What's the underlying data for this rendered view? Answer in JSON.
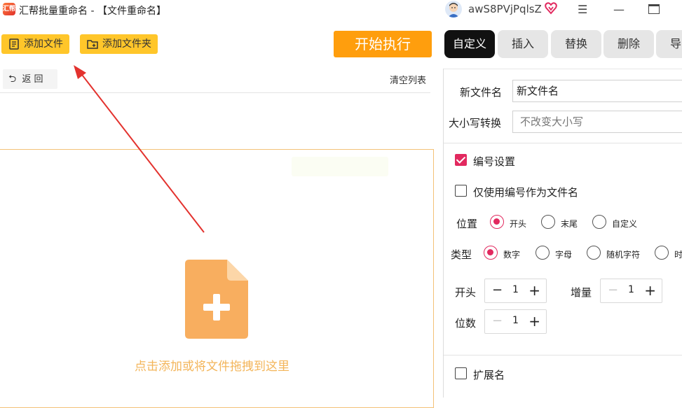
{
  "window": {
    "title": "汇帮批量重命名 - 【文件重命名】",
    "username": "awS8PVjPqlsZ",
    "logo_text": "汇帮"
  },
  "toolbar": {
    "add_file": "添加文件",
    "add_folder": "添加文件夹",
    "start": "开始执行"
  },
  "tabs": [
    {
      "label": "自定义",
      "active": true
    },
    {
      "label": "插入",
      "active": false
    },
    {
      "label": "替换",
      "active": false
    },
    {
      "label": "删除",
      "active": false
    },
    {
      "label": "导",
      "active": false
    }
  ],
  "list": {
    "back": "返 回",
    "clear": "清空列表",
    "drop_hint": "点击添加或将文件拖拽到这里"
  },
  "settings": {
    "new_name_label": "新文件名",
    "new_name_value": "新文件名",
    "case_label": "大小写转换",
    "case_value": "不改变大小写",
    "numbering_label": "编号设置",
    "numbering_checked": true,
    "only_number_label": "仅使用编号作为文件名",
    "only_number_checked": false,
    "position_label": "位置",
    "position_options": [
      "开头",
      "末尾",
      "自定义"
    ],
    "position_selected": "开头",
    "type_label": "类型",
    "type_options": [
      "数字",
      "字母",
      "随机字符",
      "时"
    ],
    "type_selected": "数字",
    "start_label": "开头",
    "start_value": "1",
    "increment_label": "增量",
    "increment_value": "1",
    "digits_label": "位数",
    "digits_value": "1",
    "extension_label": "扩展名",
    "extension_checked": false
  },
  "colors": {
    "accent": "#ffc62a",
    "start_button": "#ff9e0d",
    "check": "#e2295f",
    "drop_border": "#f3c177",
    "file_icon": "#f8ae5f",
    "arrow": "#e3322e"
  }
}
